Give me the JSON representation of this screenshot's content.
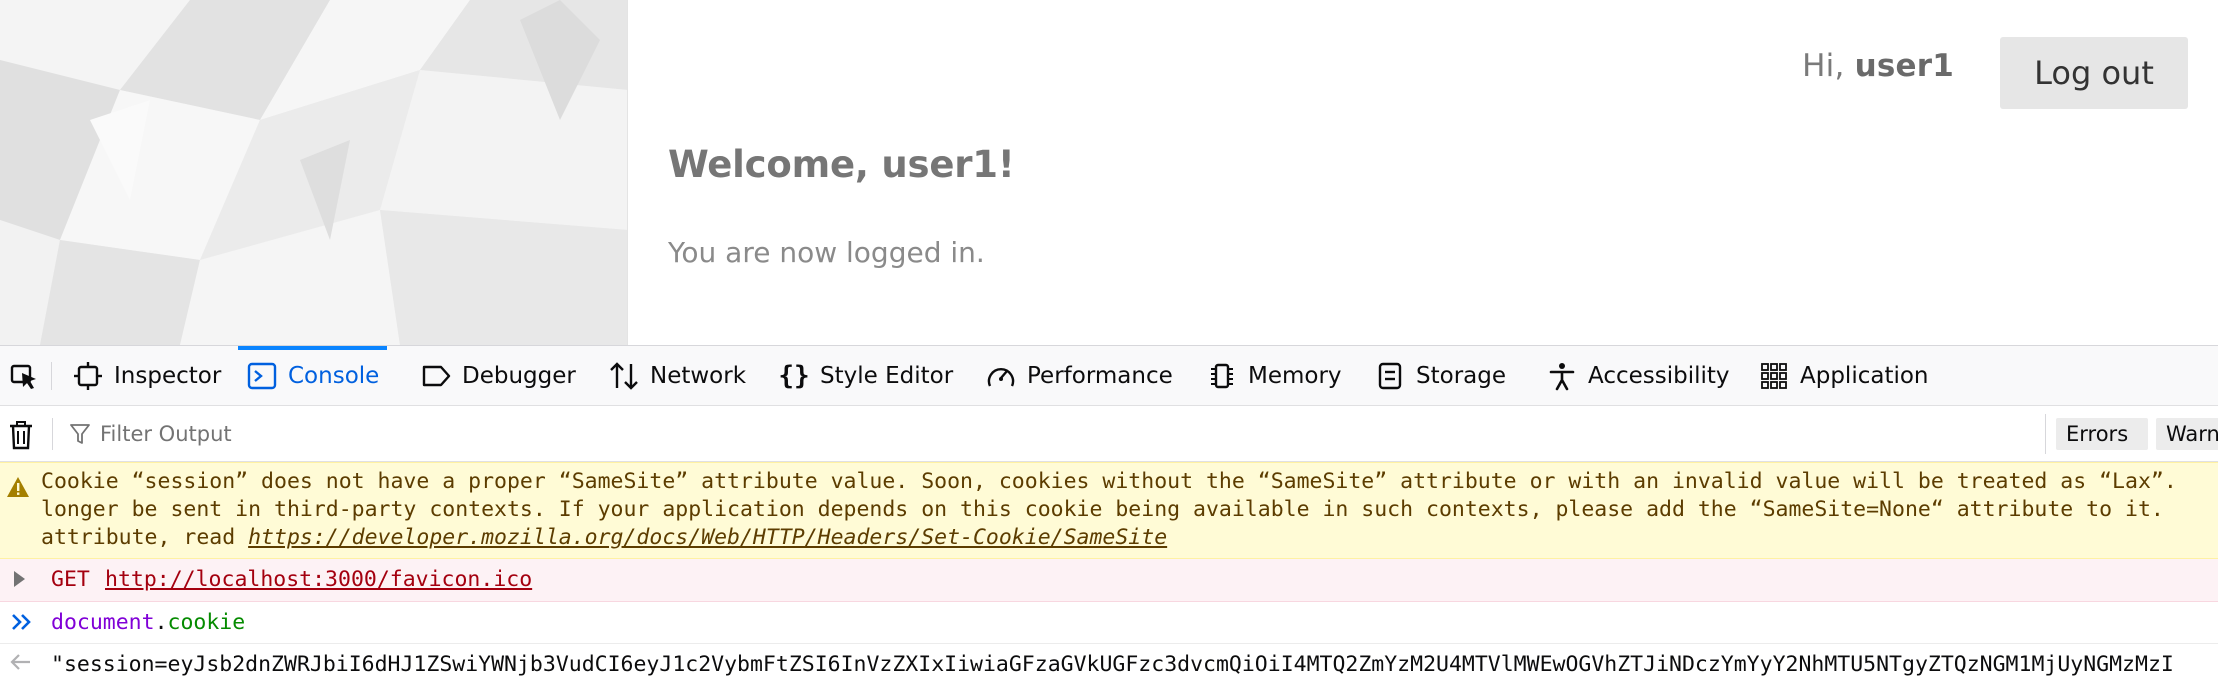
{
  "page": {
    "greeting_prefix": "Hi, ",
    "greeting_user": "user1",
    "logout_label": "Log out",
    "welcome_title": "Welcome, user1!",
    "welcome_text": "You are now logged in."
  },
  "devtools": {
    "tabs": [
      {
        "label": "Inspector",
        "icon": "inspector-icon"
      },
      {
        "label": "Console",
        "icon": "console-icon",
        "active": true
      },
      {
        "label": "Debugger",
        "icon": "debugger-icon"
      },
      {
        "label": "Network",
        "icon": "network-icon"
      },
      {
        "label": "Style Editor",
        "icon": "style-editor-icon"
      },
      {
        "label": "Performance",
        "icon": "performance-icon"
      },
      {
        "label": "Memory",
        "icon": "memory-icon"
      },
      {
        "label": "Storage",
        "icon": "storage-icon"
      },
      {
        "label": "Accessibility",
        "icon": "accessibility-icon"
      },
      {
        "label": "Application",
        "icon": "application-icon"
      }
    ],
    "filter": {
      "placeholder": "Filter Output",
      "buttons": [
        "Errors",
        "Warni"
      ]
    },
    "console": {
      "warning_line1": "Cookie “session” does not have a proper “SameSite” attribute value. Soon, cookies without the “SameSite” attribute or with an invalid value will be treated as “Lax”.",
      "warning_line2": "longer be sent in third-party contexts. If your application depends on this cookie being available in such contexts, please add the “SameSite=None“ attribute to it.",
      "warning_line3_prefix": "attribute, read ",
      "warning_link": "https://developer.mozilla.org/docs/Web/HTTP/Headers/Set-Cookie/SameSite",
      "error_method": "GET",
      "error_url": "http://localhost:3000/favicon.ico",
      "input_object": "document",
      "input_dot": ".",
      "input_property": "cookie",
      "result": "\"session=eyJsb2dnZWRJbiI6dHJ1ZSwiYWNjb3VudCI6eyJ1c2VybmFtZSI6InVzZXIxIiwiaGFzaGVkUGFzc3dvcmQiOiI4MTQ2ZmYzM2U4MTVlMWEwOGVhZTJiNDczYmYyY2NhMTU5NTgyZTQzNGM1MjUyNGMzMzI"
    },
    "colors": {
      "active_tab": "#0060df",
      "warning_bg": "#fffbd6",
      "error_bg": "#fdf2f5"
    }
  }
}
